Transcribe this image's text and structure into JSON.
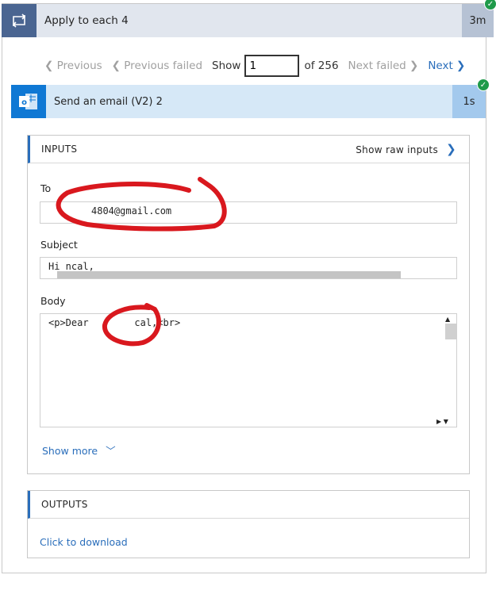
{
  "loop": {
    "title": "Apply to each 4",
    "duration": "3m",
    "icon": "loop-icon",
    "status": "success"
  },
  "pager": {
    "previous": "Previous",
    "previous_failed": "Previous failed",
    "show": "Show",
    "current": "1",
    "of": "of 256",
    "next_failed": "Next failed",
    "next": "Next"
  },
  "action": {
    "title": "Send an email (V2) 2",
    "duration": "1s",
    "icon": "outlook-icon",
    "status": "success"
  },
  "inputs": {
    "header": "INPUTS",
    "show_raw": "Show raw inputs",
    "to_label": "To",
    "to_value": "4804@gmail.com",
    "subject_label": "Subject",
    "subject_value": "Hi    ncal,",
    "body_label": "Body",
    "body_value": "<p>Dear        cal,<br>",
    "show_more": "Show more"
  },
  "outputs": {
    "header": "OUTPUTS",
    "download": "Click to download"
  },
  "colors": {
    "accent": "#2a6ebb",
    "loop_icon_bg": "#4a6591",
    "outlook_bg": "#0f78d4",
    "annotation": "#d9181e",
    "success": "#1f9a4a"
  }
}
